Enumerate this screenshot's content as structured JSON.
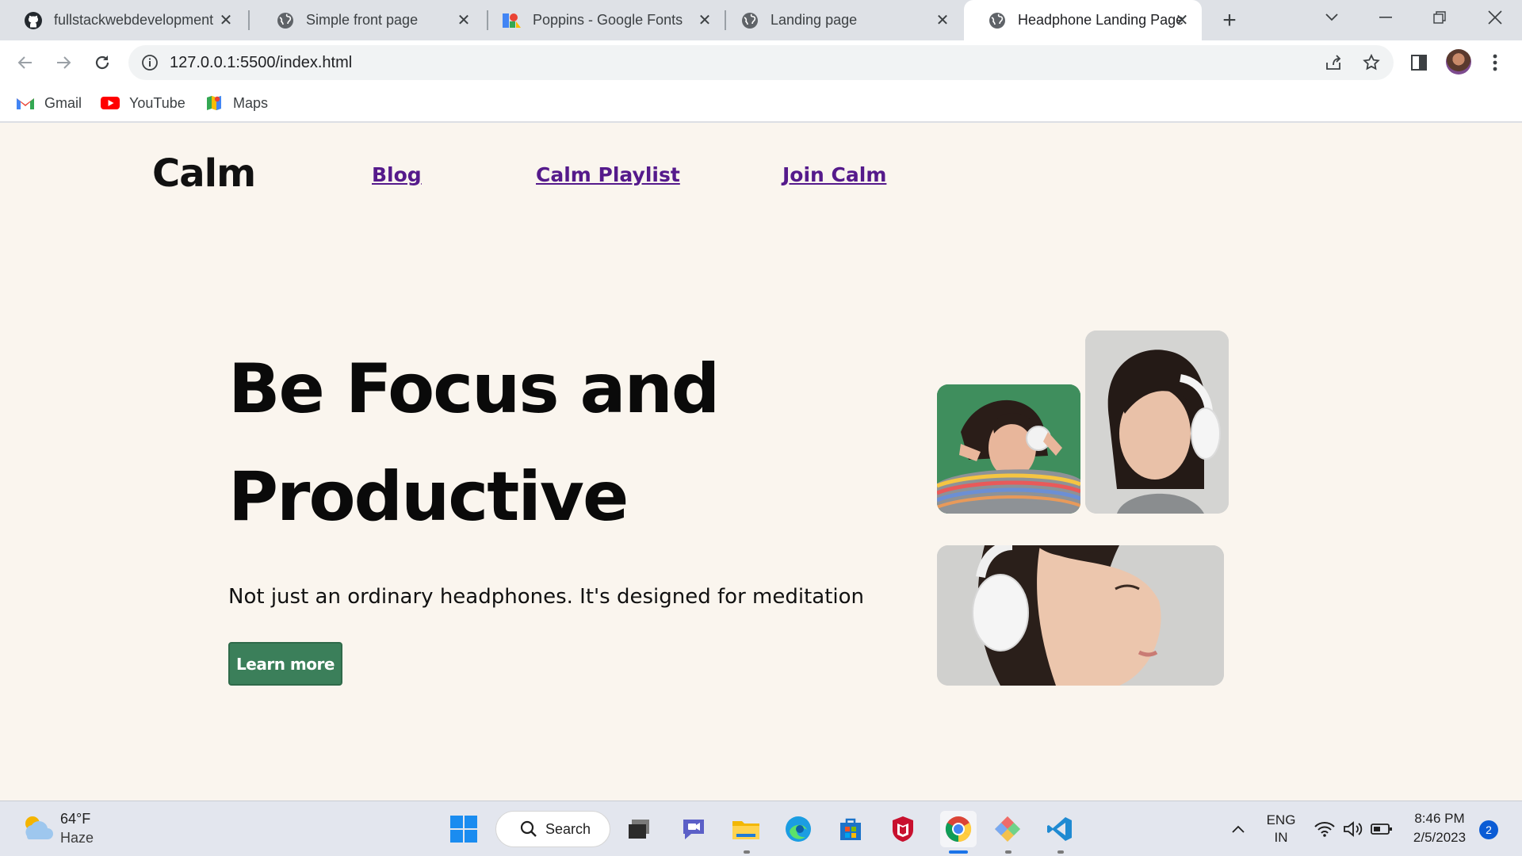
{
  "browser": {
    "tabs": [
      {
        "title": "fullstackwebdevelopment",
        "icon": "github-icon",
        "active": false
      },
      {
        "title": "Simple front page",
        "icon": "globe-icon",
        "active": false
      },
      {
        "title": "Poppins - Google Fonts",
        "icon": "google-fonts-icon",
        "active": false
      },
      {
        "title": "Landing page",
        "icon": "globe-icon",
        "active": false
      },
      {
        "title": "Headphone Landing Page",
        "icon": "globe-icon",
        "active": true
      }
    ],
    "url": "127.0.0.1:5500/index.html",
    "bookmarks": [
      {
        "label": "Gmail",
        "icon": "gmail-icon"
      },
      {
        "label": "YouTube",
        "icon": "youtube-icon"
      },
      {
        "label": "Maps",
        "icon": "maps-icon"
      }
    ]
  },
  "page": {
    "brand": "Calm",
    "nav": [
      "Blog",
      "Calm Playlist",
      "Join Calm"
    ],
    "headline_line1": "Be Focus and",
    "headline_line2": "Productive",
    "tagline": "Not just an ordinary headphones. It's designed for meditation",
    "cta": "Learn more",
    "colors": {
      "background": "#faf5ee",
      "button": "#3b7f5a",
      "link": "#551a8b"
    }
  },
  "taskbar": {
    "weather_temp": "64°F",
    "weather_condition": "Haze",
    "search_label": "Search",
    "language_line1": "ENG",
    "language_line2": "IN",
    "time": "8:46 PM",
    "date": "2/5/2023",
    "notification_count": "2"
  }
}
